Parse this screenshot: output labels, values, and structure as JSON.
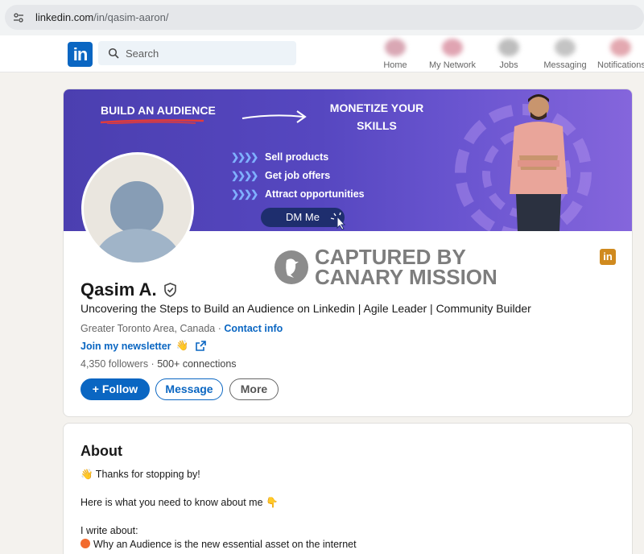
{
  "browser": {
    "url_host": "linkedin.com",
    "url_path": "/in/qasim-aaron/"
  },
  "nav": {
    "logo": "in",
    "search_placeholder": "Search",
    "items": [
      {
        "label": "Home"
      },
      {
        "label": "My Network"
      },
      {
        "label": "Jobs"
      },
      {
        "label": "Messaging"
      },
      {
        "label": "Notifications"
      }
    ]
  },
  "banner": {
    "title1": "BUILD AN AUDIENCE",
    "title2": "MONETIZE YOUR SKILLS",
    "bullets": [
      "Sell products",
      "Get job offers",
      "Attract opportunities"
    ],
    "cta": "DM Me"
  },
  "watermark": {
    "line1": "CAPTURED BY",
    "line2": "CANARY MISSION"
  },
  "profile": {
    "name": "Qasim A.",
    "headline": "Uncovering the Steps to Build an Audience on Linkedin | Agile Leader | Community Builder",
    "location": "Greater Toronto Area, Canada",
    "contact_info": "Contact info",
    "newsletter": "Join my newsletter",
    "newsletter_emoji": "👋",
    "followers": "4,350 followers",
    "connections": "500+ connections",
    "follow_label": "+ Follow",
    "message_label": "Message",
    "more_label": "More"
  },
  "about": {
    "title": "About",
    "lines": [
      "👋 Thanks for stopping by!",
      "Here is what you need to know about me 👇",
      "I write about:",
      "Why an Audience is the new essential asset on the internet"
    ]
  },
  "colors": {
    "brand": "#0a66c2",
    "banner": "#5647c0",
    "watermark": "#7d7d7d"
  }
}
